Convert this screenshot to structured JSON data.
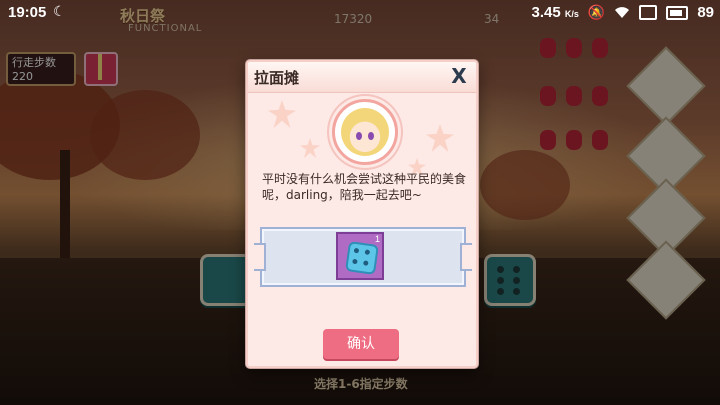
{
  "status_bar": {
    "time": "19:05",
    "network_speed": "3.45",
    "network_unit": "K/s",
    "battery": "89"
  },
  "hud": {
    "event_title": "秋日祭",
    "event_subtitle": "FUNCTIONAL",
    "counter_a": "17320",
    "counter_b": "34",
    "steps_label": "行走步数",
    "steps_value": "220",
    "bottom_hint": "选择1-6指定步数"
  },
  "dialog": {
    "title": "拉面摊",
    "close_icon": "close-icon",
    "message": "平时没有什么机会尝试这种平民的美食呢，darling，陪我一起去吧~",
    "reward": {
      "icon": "dice-icon",
      "count": "1"
    },
    "confirm_label": "确认"
  },
  "colors": {
    "dialog_bg": "#fde9e6",
    "confirm_button": "#ef6d82",
    "reward_frame": "#dde3ef",
    "reward_item": "#b06cc4"
  }
}
